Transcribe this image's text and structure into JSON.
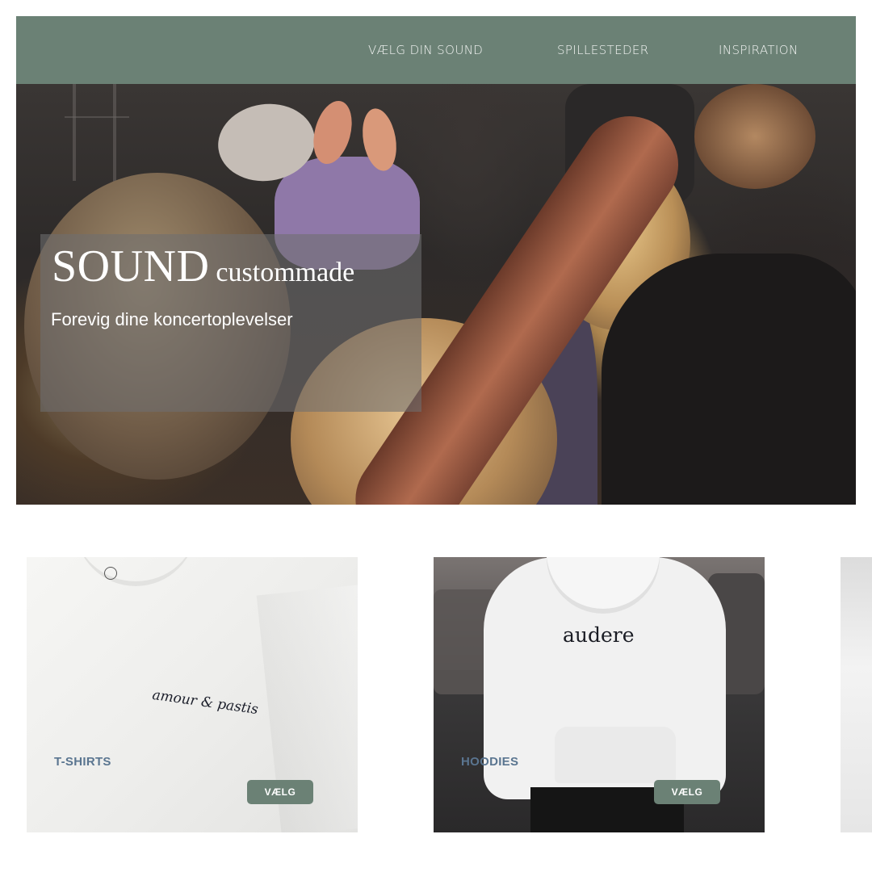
{
  "nav": {
    "items": [
      "VÆLG DIN SOUND",
      "SPILLESTEDER",
      "INSPIRATION"
    ]
  },
  "hero": {
    "title_big": "SOUND",
    "title_small": "custommade",
    "subtitle": "Forevig dine koncertoplevelser"
  },
  "products": [
    {
      "label": "T-SHIRTS",
      "button": "VÆLG",
      "print_text": "amour & pastis"
    },
    {
      "label": "HOODIES",
      "button": "VÆLG",
      "print_text": "audere"
    }
  ],
  "colors": {
    "brand_green": "#6b8175",
    "label_blue": "#5a7590",
    "nav_text": "#f3f5f3"
  }
}
